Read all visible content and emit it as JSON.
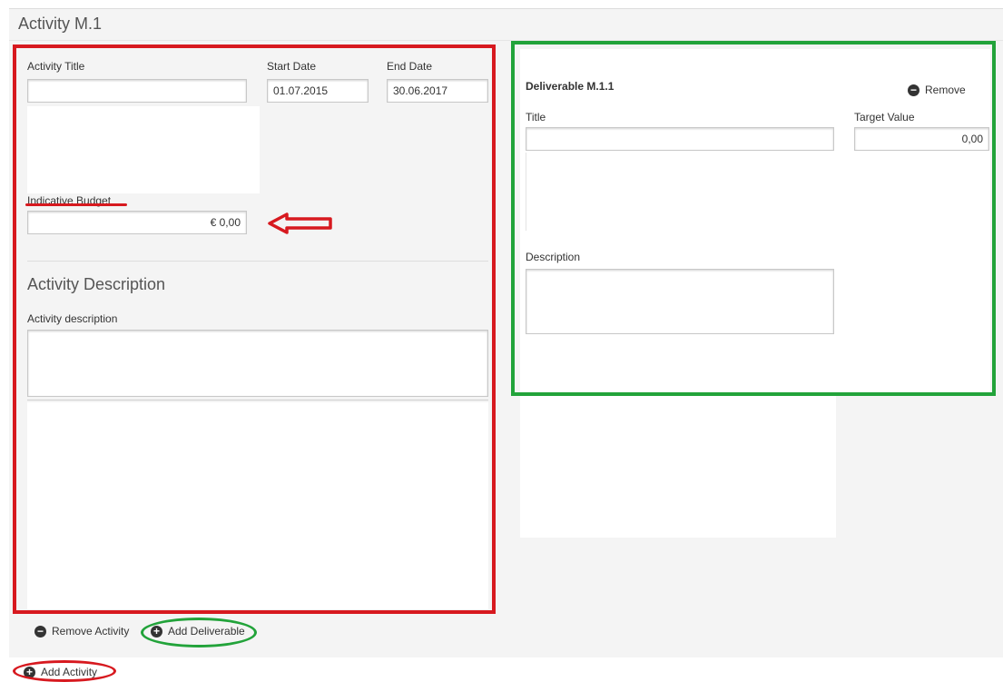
{
  "activity": {
    "header": "Activity M.1",
    "title_label": "Activity Title",
    "title_value": "",
    "start_date_label": "Start Date",
    "start_date_value": "01.07.2015",
    "end_date_label": "End Date",
    "end_date_value": "30.06.2017",
    "budget_label": "Indicative Budget",
    "budget_value": "€ 0,00",
    "description_heading": "Activity Description",
    "description_label": "Activity description",
    "description_value": ""
  },
  "deliverable": {
    "heading": "Deliverable M.1.1",
    "remove_label": "Remove",
    "title_label": "Title",
    "title_value": "",
    "target_label": "Target Value",
    "target_value": "0,00",
    "description_label": "Description",
    "description_value": ""
  },
  "actions": {
    "remove_activity": "Remove Activity",
    "add_deliverable": "Add Deliverable",
    "add_activity": "Add Activity"
  },
  "icons": {
    "minus": "minus-circle-icon",
    "plus": "plus-circle-icon"
  },
  "colors": {
    "annotation_red": "#d7191f",
    "annotation_green": "#22a33a",
    "panel_bg": "#f4f4f4"
  }
}
